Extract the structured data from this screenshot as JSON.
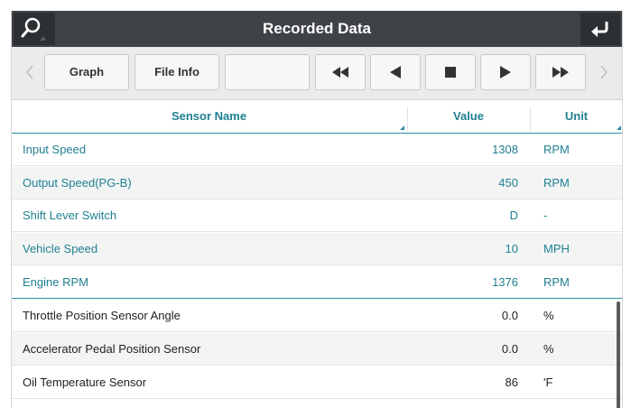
{
  "window": {
    "title": "Recorded Data"
  },
  "toolbar": {
    "graph_label": "Graph",
    "file_info_label": "File Info",
    "blank_label": ""
  },
  "table": {
    "columns": {
      "sensor": "Sensor Name",
      "value": "Value",
      "unit": "Unit"
    },
    "rows": [
      {
        "name": "Input Speed",
        "value": "1308",
        "unit": "RPM",
        "highlighted": true
      },
      {
        "name": "Output Speed(PG-B)",
        "value": "450",
        "unit": "RPM",
        "highlighted": true
      },
      {
        "name": "Shift Lever Switch",
        "value": "D",
        "unit": "-",
        "highlighted": true
      },
      {
        "name": "Vehicle Speed",
        "value": "10",
        "unit": "MPH",
        "highlighted": true
      },
      {
        "name": "Engine RPM",
        "value": "1376",
        "unit": "RPM",
        "highlighted": true
      },
      {
        "name": "Throttle Position Sensor Angle",
        "value": "0.0",
        "unit": "%",
        "highlighted": false
      },
      {
        "name": "Accelerator Pedal Position Sensor",
        "value": "0.0",
        "unit": "%",
        "highlighted": false
      },
      {
        "name": "Oil Temperature Sensor",
        "value": "86",
        "unit": "'F",
        "highlighted": false
      }
    ]
  },
  "colors": {
    "titlebar": "#3f4347",
    "accent": "#1f7f91",
    "toolbar_bg": "#ebebeb"
  }
}
